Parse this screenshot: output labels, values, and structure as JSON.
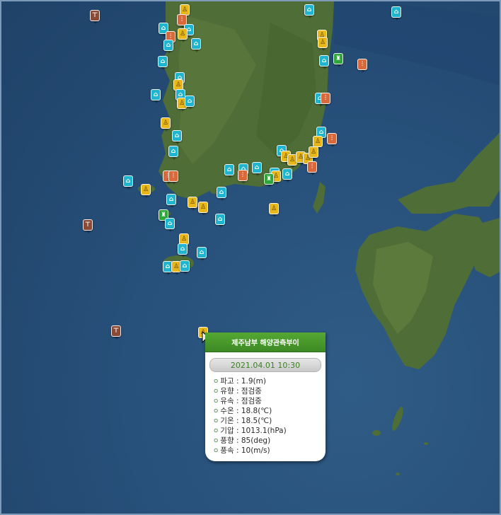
{
  "popup": {
    "title": "제주남부 해양관측부이",
    "datetime": "2021.04.01 10:30",
    "bullet": "ㅇ",
    "rows": [
      {
        "label": "파고",
        "value": "1.9(m)"
      },
      {
        "label": "유향",
        "value": "점검중"
      },
      {
        "label": "유속",
        "value": "점검중"
      },
      {
        "label": "수온",
        "value": "18.8(℃)"
      },
      {
        "label": "기온",
        "value": "18.5(℃)"
      },
      {
        "label": "기압",
        "value": "1013.1(hPa)"
      },
      {
        "label": "풍향",
        "value": "85(deg)"
      },
      {
        "label": "풍속",
        "value": "10(m/s)"
      }
    ]
  },
  "marker_types": {
    "cyan": "home-icon",
    "yellow": "buoy-icon",
    "orange": "station-icon",
    "brown": "platform-icon",
    "green": "lighthouse-icon"
  },
  "colors": {
    "sea": "#27507a",
    "land": "#4f6d36",
    "marker_cyan": "#1fb4cf",
    "marker_yellow": "#e8b81a",
    "marker_orange": "#d9693a",
    "marker_brown": "#8a4a36",
    "marker_green": "#2fa63a",
    "popup_header": "#4a9a2c"
  }
}
